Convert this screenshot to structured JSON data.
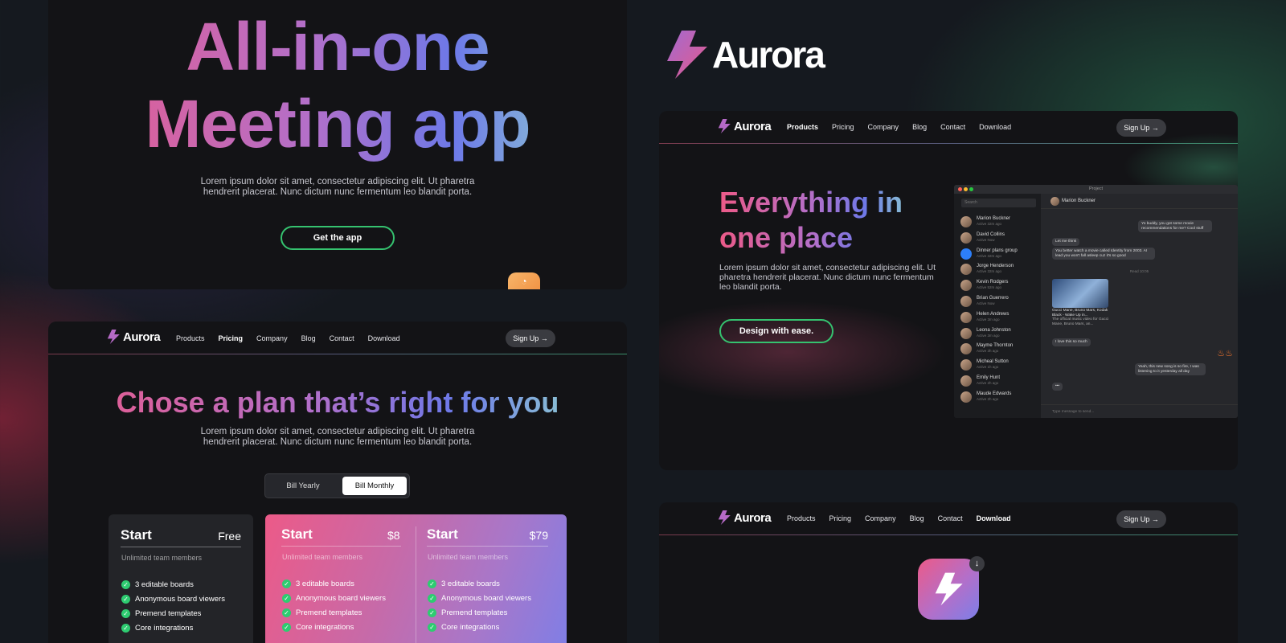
{
  "brand": {
    "name": "Aurora",
    "logo_icon": "lightning-bolt-icon",
    "accent_green": "#35c26f",
    "gradient": [
      "#ec5a88",
      "#b36fc9",
      "#6d79e8",
      "#9ae8c9"
    ]
  },
  "hero": {
    "title_line1": "All-in-one",
    "title_line2": "Meeting app",
    "body": "Lorem ipsum dolor sit amet, consectetur adipiscing elit. Ut pharetra hendrerit placerat. Nunc dictum nunc fermentum leo blandit porta.",
    "cta": "Get the app"
  },
  "nav": {
    "items": [
      "Products",
      "Pricing",
      "Company",
      "Blog",
      "Contact",
      "Download"
    ],
    "signup": "Sign Up"
  },
  "pricing": {
    "title": "Chose a plan that’s right for you",
    "body": "Lorem ipsum dolor sit amet, consectetur adipiscing elit. Ut pharetra hendrerit placerat. Nunc dictum nunc fermentum leo blandit porta.",
    "toggle": [
      "Bill Yearly",
      "Bill Monthly"
    ],
    "selected_toggle": "Bill Monthly",
    "plans": [
      {
        "name": "Start",
        "price": "Free",
        "subtitle": "Unlimited team members"
      },
      {
        "name": "Start",
        "price": "$8",
        "subtitle": "Unlimited team members"
      },
      {
        "name": "Start",
        "price": "$79",
        "subtitle": "Unlimited team members"
      }
    ],
    "features": [
      "3 editable boards",
      "Anonymous board viewers",
      "Premend templates",
      "Core integrations"
    ]
  },
  "products": {
    "title_line1": "Everything in",
    "title_line2": "one place",
    "body": "Lorem ipsum dolor sit amet, consectetur adipiscing elit. Ut pharetra hendrerit placerat. Nunc dictum nunc fermentum leo blandit porta.",
    "cta": "Design with ease."
  },
  "app": {
    "window_title": "Project",
    "search_placeholder": "Search",
    "active_contact": "Marion Buckner",
    "contacts": [
      {
        "name": "Marion Buckner",
        "status": "Active 32m ago"
      },
      {
        "name": "David Collins",
        "status": "Active Now"
      },
      {
        "name": "Dinner plans group",
        "status": "Active 32m ago"
      },
      {
        "name": "Jorge Henderson",
        "status": "Active 32m ago"
      },
      {
        "name": "Kevin Rodgers",
        "status": "Active 52m ago"
      },
      {
        "name": "Brian Guerrero",
        "status": "Active Now"
      },
      {
        "name": "Helen Andrews",
        "status": "Active 3m ago"
      },
      {
        "name": "Leona Johnston",
        "status": "Active 3m ago"
      },
      {
        "name": "Mayme Thornton",
        "status": "Active 3h ago"
      },
      {
        "name": "Micheal Sutton",
        "status": "Active 1h ago"
      },
      {
        "name": "Emily Hunt",
        "status": "Active 2h ago"
      },
      {
        "name": "Maude Edwards",
        "status": "Active 2h ago"
      }
    ],
    "messages": {
      "m1": "Yo buddy, you got some movie recommendations for me? Cool stuff",
      "m2": "Let me think",
      "m3": "You better watch a movie called Identity from 2003. AI lead you won't fall asleep cuz it's so good",
      "time": "Read 10:05",
      "m4": "Gucci Mane, Bruno Mars, Kodak Black - Wake Up in...",
      "m5": "The official music video for Gucci Mane, Bruno Mars, an...",
      "m6": "I love this so much",
      "m7": "Yeah, this new song is so fire, I was listening to it yesterday all day",
      "typing": "•••",
      "input_placeholder": "Type message to send..."
    }
  }
}
